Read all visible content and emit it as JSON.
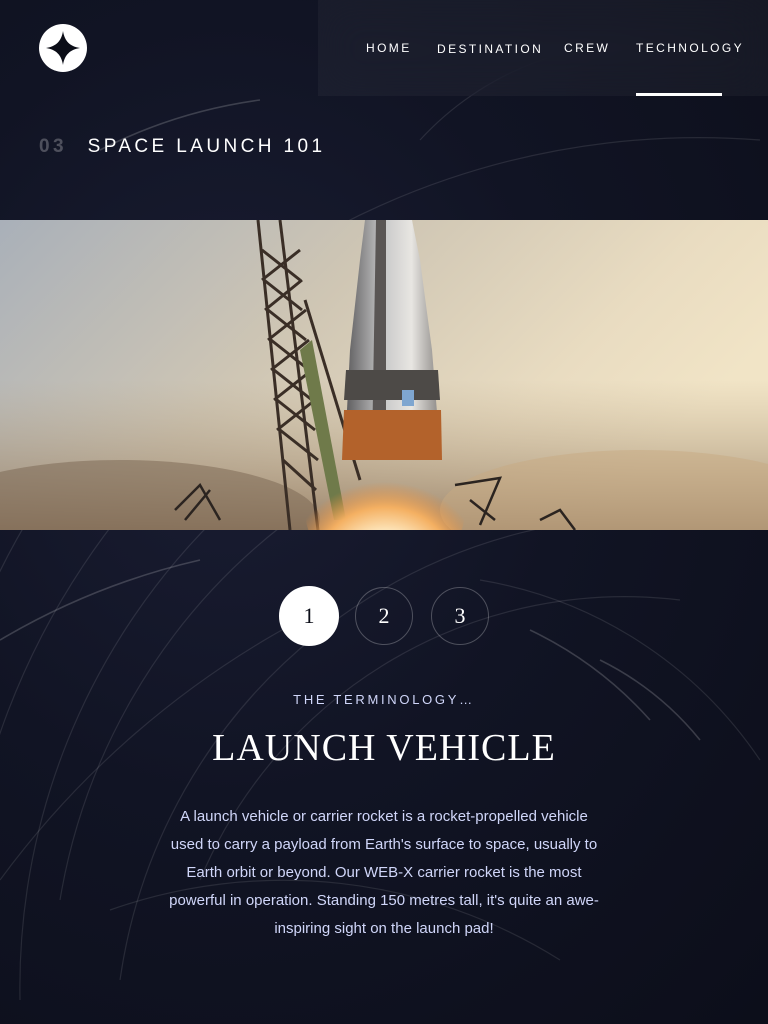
{
  "header": {
    "logo_icon": "four-point-star-icon",
    "nav": [
      {
        "label": "Home",
        "active": false
      },
      {
        "label": "Destination",
        "active": false
      },
      {
        "label": "Crew",
        "active": false
      },
      {
        "label": "Technology",
        "active": true
      }
    ]
  },
  "page": {
    "number": "03",
    "heading": "Space launch 101"
  },
  "hero": {
    "image_subject": "rocket-launch-photo"
  },
  "pager": {
    "items": [
      "1",
      "2",
      "3"
    ],
    "active_index": 0
  },
  "content": {
    "subtitle": "The terminology…",
    "title": "Launch vehicle",
    "description": "A launch vehicle or carrier rocket is a rocket-propelled vehicle used to carry a payload from Earth's surface to space, usually to Earth orbit or beyond. Our WEB-X carrier rocket is the most powerful in operation. Standing 150 metres tall, it's quite an awe-inspiring sight on the launch pad!"
  },
  "colors": {
    "background": "#0b0d17",
    "text_primary": "#ffffff",
    "text_secondary": "#d0d6f9"
  }
}
